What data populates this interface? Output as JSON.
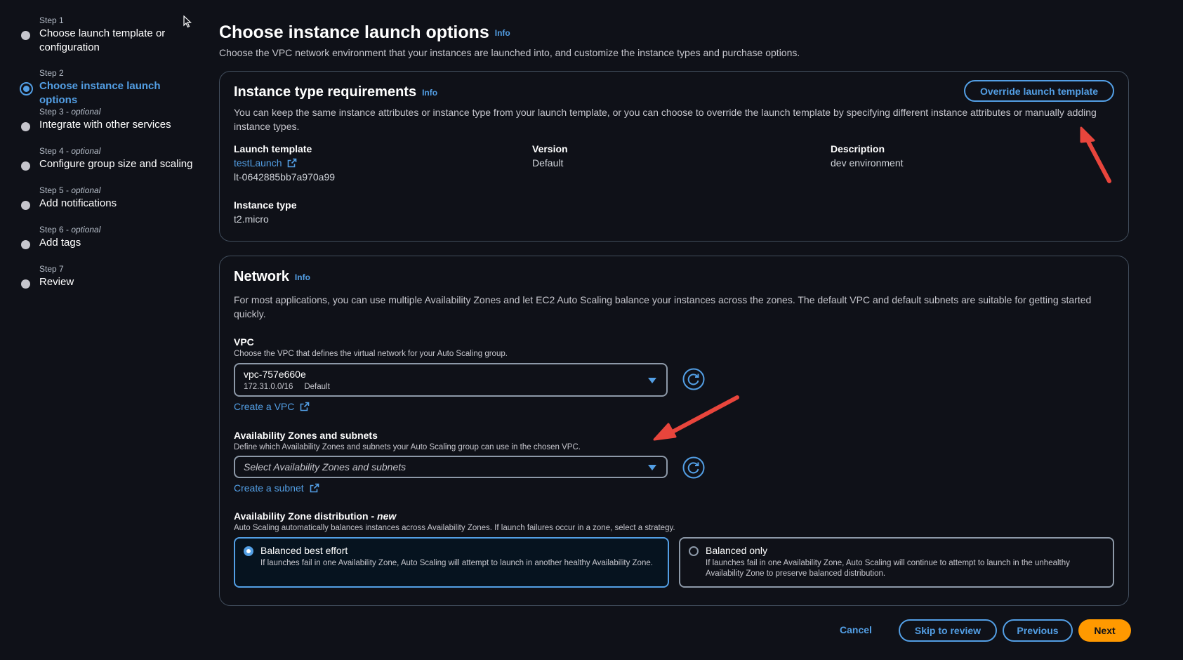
{
  "steps": [
    {
      "num": "Step 1",
      "optional": "",
      "label": "Choose launch template or configuration"
    },
    {
      "num": "Step 2",
      "optional": "",
      "label": "Choose instance launch options"
    },
    {
      "num": "Step 3 - ",
      "optional": "optional",
      "label": "Integrate with other services"
    },
    {
      "num": "Step 4 - ",
      "optional": "optional",
      "label": "Configure group size and scaling"
    },
    {
      "num": "Step 5 - ",
      "optional": "optional",
      "label": "Add notifications"
    },
    {
      "num": "Step 6 - ",
      "optional": "optional",
      "label": "Add tags"
    },
    {
      "num": "Step 7",
      "optional": "",
      "label": "Review"
    }
  ],
  "page": {
    "title": "Choose instance launch options",
    "info": "Info",
    "description": "Choose the VPC network environment that your instances are launched into, and customize the instance types and purchase options."
  },
  "instance_panel": {
    "title": "Instance type requirements",
    "info": "Info",
    "override_button": "Override launch template",
    "description": "You can keep the same instance attributes or instance type from your launch template, or you can choose to override the launch template by specifying different instance attributes or manually adding instance types.",
    "launch_template_label": "Launch template",
    "launch_template_link": "testLaunch",
    "launch_template_id": "lt-0642885bb7a970a99",
    "version_label": "Version",
    "version_value": "Default",
    "description_label": "Description",
    "description_value": "dev environment",
    "instance_type_label": "Instance type",
    "instance_type_value": "t2.micro"
  },
  "network_panel": {
    "title": "Network",
    "info": "Info",
    "description": "For most applications, you can use multiple Availability Zones and let EC2 Auto Scaling balance your instances across the zones. The default VPC and default subnets are suitable for getting started quickly.",
    "vpc_label": "VPC",
    "vpc_desc": "Choose the VPC that defines the virtual network for your Auto Scaling group.",
    "vpc_value": "vpc-757e660e",
    "vpc_cidr": "172.31.0.0/16",
    "vpc_tag": "Default",
    "create_vpc": "Create a VPC",
    "az_label": "Availability Zones and subnets",
    "az_desc": "Define which Availability Zones and subnets your Auto Scaling group can use in the chosen VPC.",
    "az_placeholder": "Select Availability Zones and subnets",
    "create_subnet": "Create a subnet",
    "dist_label": "Availability Zone distribution - ",
    "dist_new": "new",
    "dist_desc": "Auto Scaling automatically balances instances across Availability Zones. If launch failures occur in a zone, select a strategy.",
    "options": [
      {
        "title": "Balanced best effort",
        "desc": "If launches fail in one Availability Zone, Auto Scaling will attempt to launch in another healthy Availability Zone.",
        "selected": true
      },
      {
        "title": "Balanced only",
        "desc": "If launches fail in one Availability Zone, Auto Scaling will continue to attempt to launch in the unhealthy Availability Zone to preserve balanced distribution.",
        "selected": false
      }
    ]
  },
  "footer": {
    "cancel": "Cancel",
    "skip": "Skip to review",
    "previous": "Previous",
    "next": "Next"
  },
  "colors": {
    "accent": "#539fe5",
    "primary": "#ff9900",
    "annotation_arrow": "#e8453c"
  }
}
